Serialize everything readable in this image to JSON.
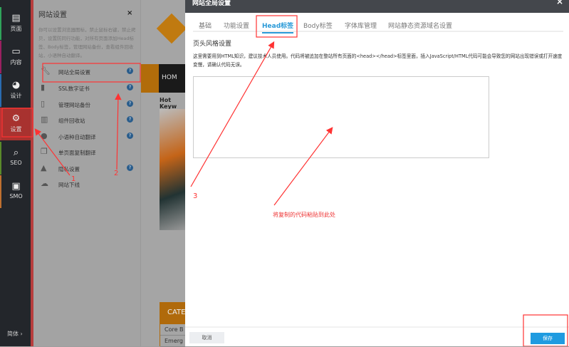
{
  "sidebar": {
    "items": [
      {
        "label": "页面",
        "icon": "page-icon"
      },
      {
        "label": "内容",
        "icon": "content-icon"
      },
      {
        "label": "设计",
        "icon": "palette-icon"
      },
      {
        "label": "设置",
        "icon": "gear-icon"
      },
      {
        "label": "SEO",
        "icon": "search-icon"
      },
      {
        "label": "SMO",
        "icon": "briefcase-icon"
      }
    ],
    "language": "简体 ›"
  },
  "panel": {
    "title": "网站设置",
    "close": "×",
    "description": "你可以设置浏览器图标，禁止鼠标右键，禁止拷贝，设置防同行功能，对所有页面添加Head标签、Body标签，管理网站备份，查看组件回收站，小语种自动翻译。",
    "items": [
      {
        "label": "网站全局设置",
        "icon": "wrench-icon",
        "help": true
      },
      {
        "label": "SSL数字证书",
        "icon": "lock-icon",
        "help": true
      },
      {
        "label": "管理网站备份",
        "icon": "archive-icon",
        "help": true
      },
      {
        "label": "组件回收站",
        "icon": "trash-icon",
        "help": true
      },
      {
        "label": "小语种自动翻译",
        "icon": "globe-icon",
        "help": true
      },
      {
        "label": "单页面复制翻译",
        "icon": "copy-icon",
        "help": false
      },
      {
        "label": "隐私设置",
        "icon": "privacy-icon",
        "help": true
      },
      {
        "label": "网站下线",
        "icon": "cloud-download-icon",
        "help": false
      }
    ]
  },
  "site": {
    "nav_home": "HOM",
    "hot_keywords": "Hot Keyw",
    "category": "CATE",
    "rows": [
      "Core B",
      "Emerg"
    ]
  },
  "modal": {
    "title": "网站全局设置",
    "close": "×",
    "tabs": [
      "基础",
      "功能设置",
      "Head标签",
      "Body标签",
      "字体库管理",
      "网站静态资源域名设置"
    ],
    "active_tab": "Head标签",
    "section_title": "页头风格设置",
    "description": "这里需要用到HTML知识，建议技术人员使用。代码将被追加在整站所有页面的<head></head>标签里面，插入JavaScript/HTML代码可能会导致您的网站出现错误或打开速度变慢，请确认代码无误。",
    "textarea_value": "",
    "cancel": "取消",
    "save": "保存"
  },
  "annotations": {
    "step1": "1",
    "step2": "2",
    "step3": "3",
    "hint": "将复制的代码粘贴到此处",
    "color": "#ff3333"
  }
}
